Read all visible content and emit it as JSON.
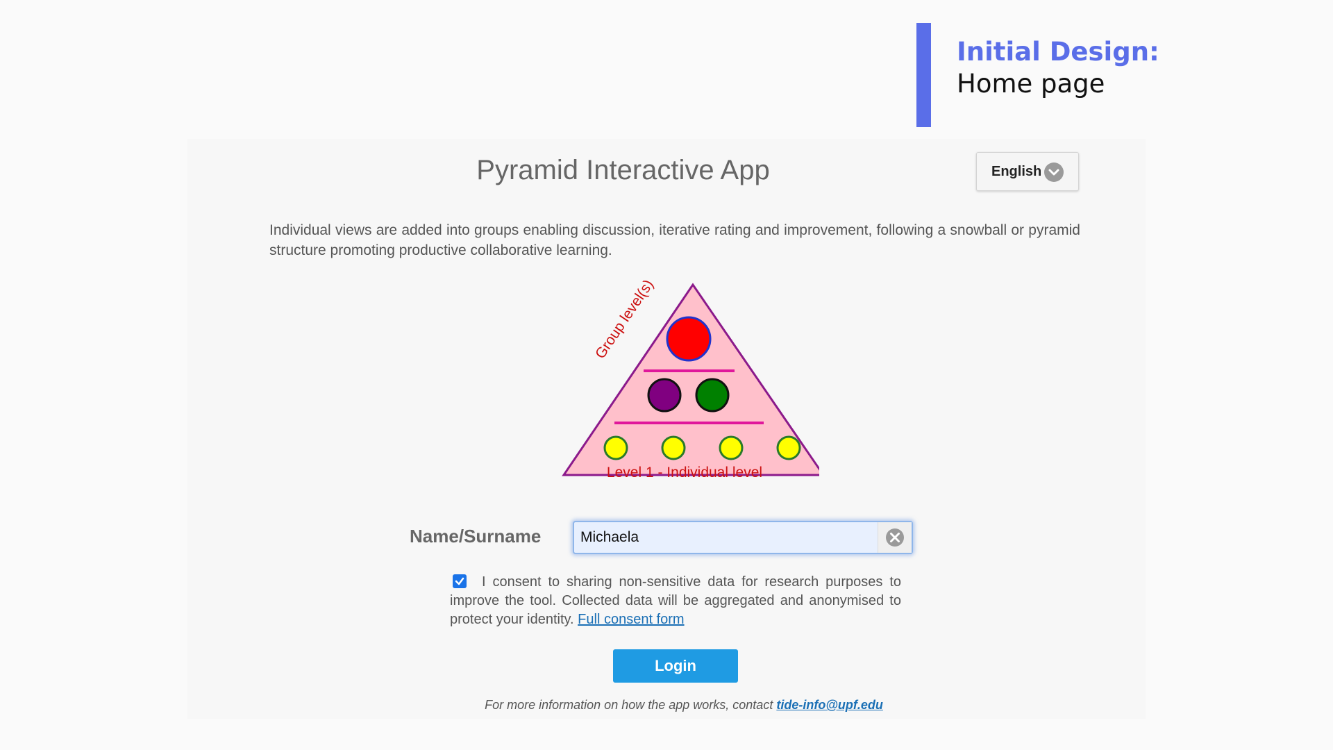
{
  "slide": {
    "title_line1": "Initial Design:",
    "title_line2": "Home page",
    "accent_color": "#5a6ee8"
  },
  "app": {
    "title": "Pyramid Interactive App",
    "language": {
      "selected": "English",
      "icon": "chevron-down-icon"
    },
    "description": "Individual views are added into groups enabling discussion, iterative rating and improvement, following a snowball or pyramid structure promoting productive collaborative learning.",
    "pyramid": {
      "group_label": "Group level(s)",
      "level1_label": "Level 1 - Individual level",
      "colors": {
        "fill": "#ffc0cb",
        "outline": "#8b1a8b",
        "divider": "#e0179b",
        "top": "#ff0000",
        "mid_left": "#800080",
        "mid_right": "#008000",
        "base": "#ffff00"
      }
    },
    "form": {
      "name_label": "Name/Surname",
      "name_value": "Michaela",
      "clear_icon": "clear-circle-icon",
      "consent_checked": true,
      "consent_text": "I consent to sharing non-sensitive data for research purposes to improve the tool. Collected data will be aggregated and anonymised to protect your identity.",
      "consent_link": "Full consent form",
      "login_label": "Login"
    },
    "footer": {
      "text": "For more information on how the app works, contact",
      "email": "tide-info@upf.edu"
    }
  }
}
